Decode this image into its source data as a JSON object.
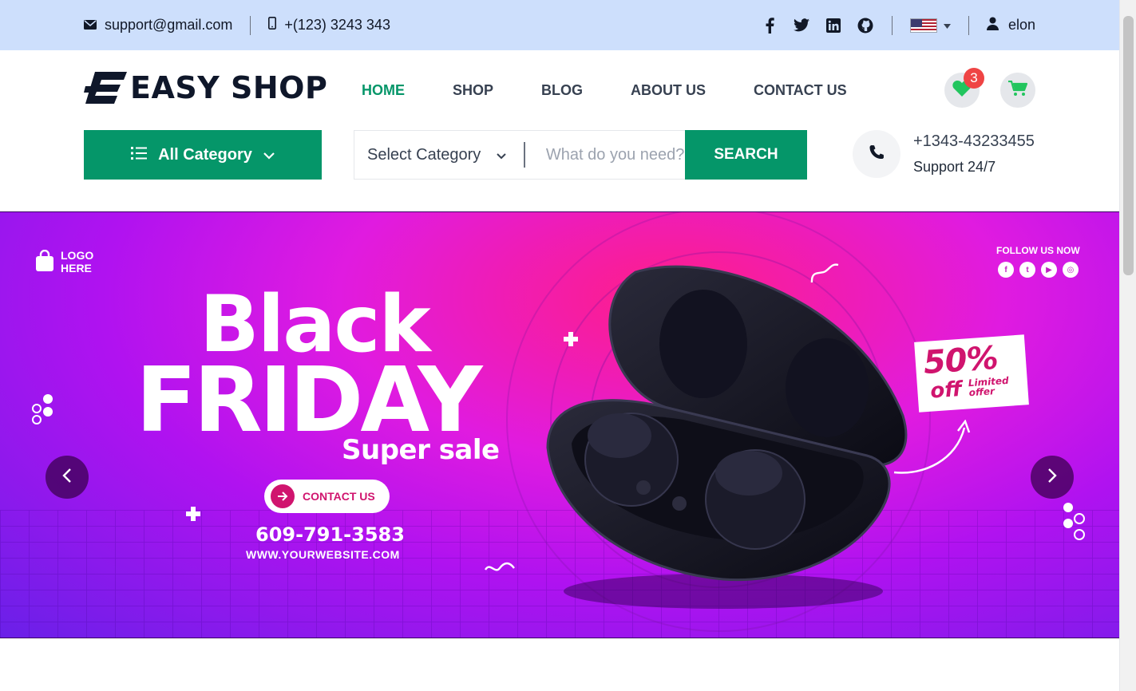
{
  "topbar": {
    "email": "support@gmail.com",
    "phone": "+(123) 3243 343",
    "social": [
      "facebook-icon",
      "twitter-icon",
      "linkedin-icon",
      "github-icon"
    ],
    "language": "en-US",
    "username": "elon"
  },
  "header": {
    "logo_text": "EASY SHOP",
    "nav": [
      {
        "label": "HOME",
        "active": true
      },
      {
        "label": "SHOP",
        "active": false
      },
      {
        "label": "BLOG",
        "active": false
      },
      {
        "label": "ABOUT US",
        "active": false
      },
      {
        "label": "CONTACT US",
        "active": false
      }
    ],
    "wishlist_count": "3"
  },
  "searchbar": {
    "all_category_label": "All Category",
    "select_category": "Select Category",
    "placeholder": "What do you need?",
    "search_button": "SEARCH"
  },
  "support": {
    "phone": "+1343-43233455",
    "label": "Support 24/7"
  },
  "banner": {
    "logo_line1": "LOGO",
    "logo_line2": "HERE",
    "follow": "FOLLOW US NOW",
    "headline1": "Black",
    "headline2": "FRIDAY",
    "subheadline": "Super sale",
    "cta": "CONTACT US",
    "phone": "609-791-3583",
    "website": "WWW.YOURWEBSITE.COM",
    "discount": "50%",
    "discount_off": "off",
    "limited1": "Limited",
    "limited2": "offer"
  },
  "colors": {
    "accent": "#059669",
    "topbar": "#cddffc",
    "badge": "#ef4444"
  }
}
